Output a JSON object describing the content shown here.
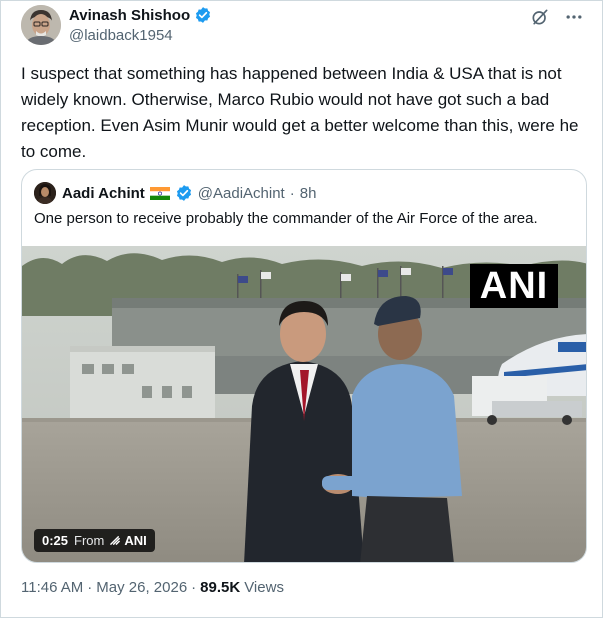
{
  "post": {
    "author_name": "Avinash Shishoo",
    "author_handle": "@laidback1954",
    "avatar_icon": "user-avatar-photo",
    "verified_icon": "verified-badge-icon",
    "text": "I suspect that something has happened between India & USA that is not widely known. Otherwise, Marco Rubio would not have got such a bad reception. Even Asim Munir would get a better welcome than this, were he to come.",
    "actions": [
      "grok-icon",
      "more-icon"
    ]
  },
  "quoted": {
    "author_name": "Aadi Achint",
    "flag": "india-flag-icon",
    "handle": "@AadiAchint",
    "separator": "·",
    "time": "8h",
    "text": "One person to receive probably the commander of the Air Force of the area.",
    "media": {
      "watermark": "ANI",
      "duration": "0:25",
      "from_label": "From",
      "source": "ANI"
    }
  },
  "meta": {
    "time": "11:46 AM",
    "sep1": "·",
    "date": "May 26, 2026",
    "sep2": "·",
    "views_count": "89.5K",
    "views_label": "Views"
  },
  "colors": {
    "accent_verified": "#1d9bf0",
    "text_primary": "#0f1419",
    "text_secondary": "#536471",
    "border": "#cfd9de"
  }
}
